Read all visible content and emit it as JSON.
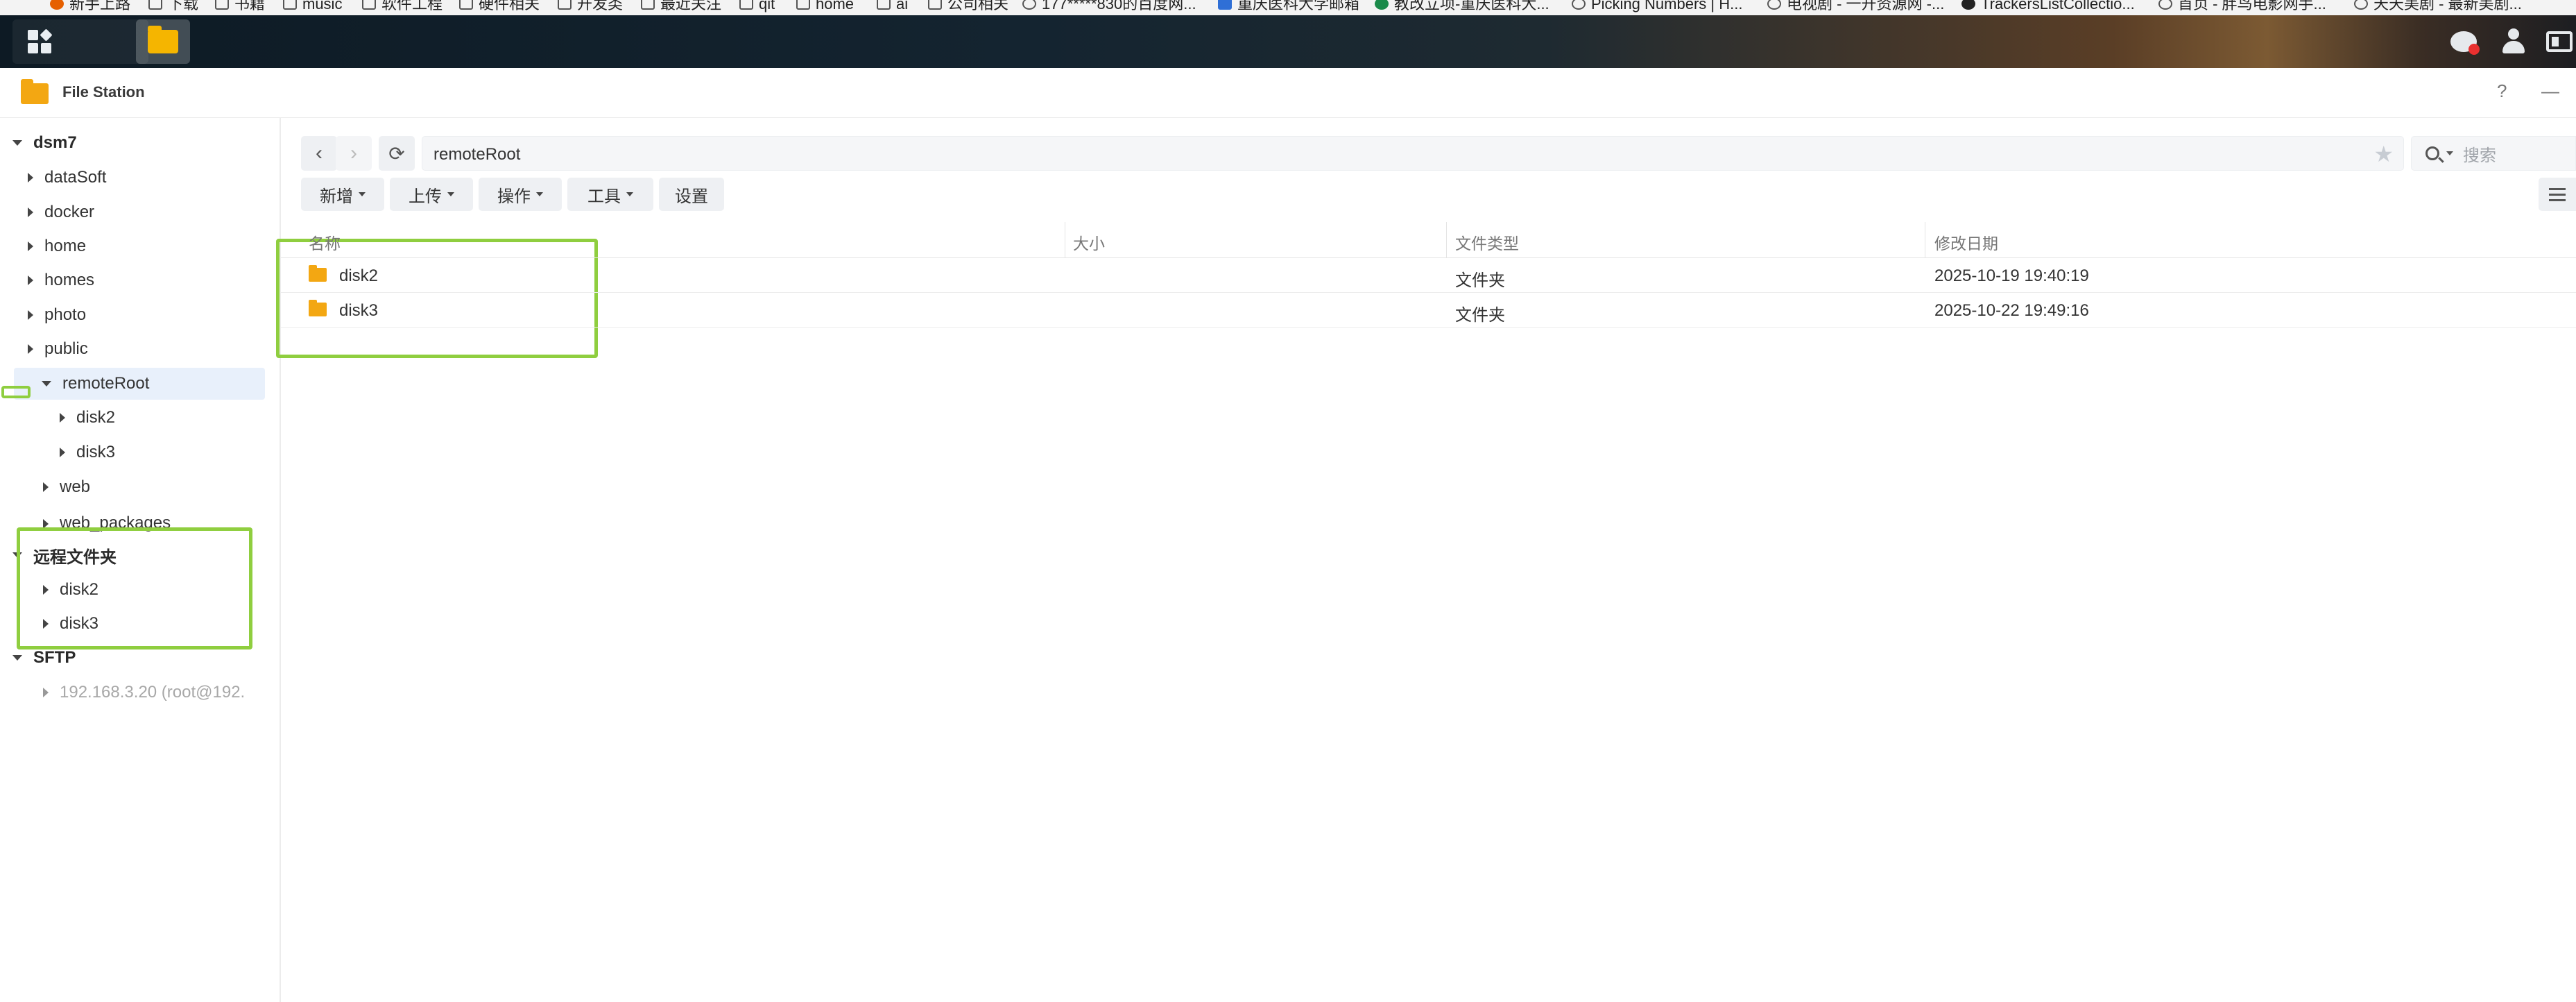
{
  "bookmarks": [
    {
      "label": "新手上路",
      "icon": "firefox-icon"
    },
    {
      "label": "下载",
      "icon": "folder-icon"
    },
    {
      "label": "书籍",
      "icon": "folder-icon"
    },
    {
      "label": "music",
      "icon": "folder-icon"
    },
    {
      "label": "软件工程",
      "icon": "folder-icon"
    },
    {
      "label": "硬件相关",
      "icon": "folder-icon"
    },
    {
      "label": "开发类",
      "icon": "folder-icon"
    },
    {
      "label": "最近关注",
      "icon": "folder-icon"
    },
    {
      "label": "qit",
      "icon": "folder-icon"
    },
    {
      "label": "home",
      "icon": "folder-icon"
    },
    {
      "label": "ai",
      "icon": "folder-icon"
    },
    {
      "label": "公司相关",
      "icon": "folder-icon"
    },
    {
      "label": "177*****830的百度网...",
      "icon": "globe-icon"
    },
    {
      "label": "重庆医科大学邮箱",
      "icon": "mail-icon"
    },
    {
      "label": "教改立项-重庆医科大...",
      "icon": "g-icon"
    },
    {
      "label": "Picking Numbers | H...",
      "icon": "globe-icon"
    },
    {
      "label": "电视剧 - 一开资源网 -...",
      "icon": "globe-icon"
    },
    {
      "label": "TrackersListCollectio...",
      "icon": "github-icon"
    },
    {
      "label": "首页 - 胖鸟电影网手...",
      "icon": "globe-icon"
    },
    {
      "label": "天天美剧 - 最新美剧...",
      "icon": "globe-icon"
    }
  ],
  "window": {
    "title": "File Station",
    "help": "?",
    "minimize": "—"
  },
  "sidebar": {
    "root": "dsm7",
    "items": [
      "dataSoft",
      "docker",
      "home",
      "homes",
      "photo",
      "public",
      "remoteRoot",
      "disk2",
      "disk3",
      "web",
      "web_packages"
    ],
    "remote_section": "远程文件夹",
    "remote_items": [
      "disk2",
      "disk3"
    ],
    "sftp_section": "SFTP",
    "sftp_items": [
      "192.168.3.20 (root@192."
    ]
  },
  "path": {
    "current": "remoteRoot"
  },
  "search": {
    "placeholder": "搜索"
  },
  "toolbar": {
    "new": "新增",
    "upload": "上传",
    "action": "操作",
    "tools": "工具",
    "settings": "设置"
  },
  "table": {
    "columns": [
      "名称",
      "大小",
      "文件类型",
      "修改日期"
    ],
    "rows": [
      {
        "name": "disk2",
        "size": "",
        "type": "文件夹",
        "modified": "2025-10-19 19:40:19"
      },
      {
        "name": "disk3",
        "size": "",
        "type": "文件夹",
        "modified": "2025-10-22 19:49:16"
      }
    ]
  },
  "colors": {
    "highlight": "#8fce3f",
    "folder": "#f3a712",
    "selected_row": "#e8f0fb"
  }
}
